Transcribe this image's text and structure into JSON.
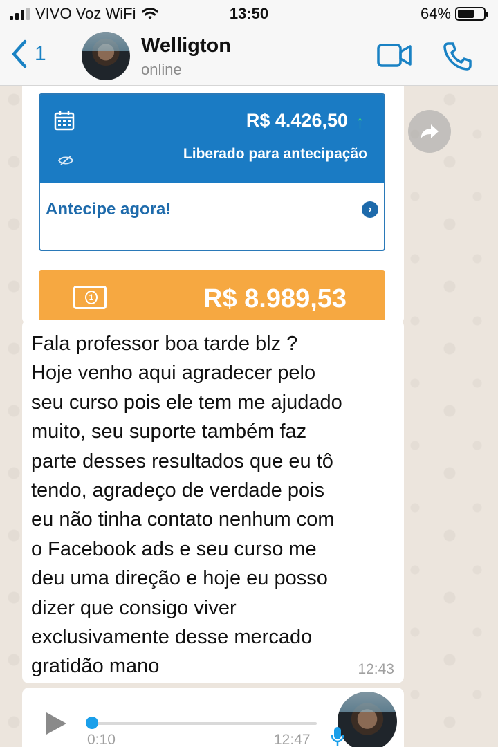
{
  "status_bar": {
    "carrier": "VIVO Voz WiFi",
    "time": "13:50",
    "battery_percent": "64%",
    "battery_level": 0.64
  },
  "header": {
    "back_count": "1",
    "contact_name": "Welligton",
    "contact_status": "online",
    "icons": [
      "chevron-left-icon",
      "video-camera-icon",
      "phone-icon"
    ]
  },
  "image_message": {
    "balance_amount": "R$ 4.426,50",
    "balance_label": "Liberado para antecipação",
    "anticipate_cta": "Antecipe agora!",
    "total_amount": "R$ 8.989,53",
    "colors": {
      "blue": "#1a7bc4",
      "orange": "#f6a841",
      "link": "#1d6aab",
      "up_arrow": "#3bd47a"
    },
    "icons": [
      "calendar-icon",
      "eye-off-icon",
      "up-arrow-icon",
      "arrow-right-circle-icon",
      "money-bill-icon"
    ]
  },
  "text_message": {
    "text": "Fala professor boa tarde blz ?\nHoje venho aqui agradecer pelo\nseu curso pois ele tem me ajudado\nmuito, seu suporte também faz\nparte desses resultados que eu tô\ntendo, agradeço de verdade pois\neu não tinha contato nenhum com\no Facebook ads e seu curso me\ndeu uma direção e hoje eu posso\ndizer que consigo viver\nexclusivamente desse mercado\ngratidão mano",
    "time": "12:43"
  },
  "audio_message": {
    "duration": "0:10",
    "time": "12:47",
    "progress": 0.0,
    "icons": [
      "play-icon",
      "mic-icon"
    ]
  },
  "accent_color": "#1a82c4"
}
